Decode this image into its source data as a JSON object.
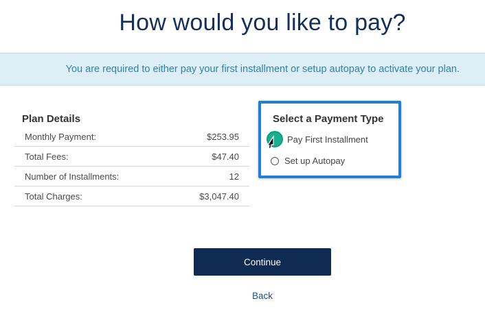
{
  "header": {
    "title": "How would you like to pay?"
  },
  "notice": {
    "text": "You are required to either pay your first installment or setup autopay to activate your plan."
  },
  "plan_details": {
    "title": "Plan Details",
    "rows": [
      {
        "label": "Monthly Payment:",
        "value": "$253.95"
      },
      {
        "label": "Total Fees:",
        "value": "$47.40"
      },
      {
        "label": "Number of Installments:",
        "value": "12"
      },
      {
        "label": "Total Charges:",
        "value": "$3,047.40"
      }
    ]
  },
  "payment_type": {
    "title": "Select a Payment Type",
    "options": [
      {
        "label": "Pay First Installment",
        "selected": true
      },
      {
        "label": "Set up Autopay",
        "selected": false
      }
    ],
    "accent_color": "#1f7fd6",
    "selected_color": "#19b08e"
  },
  "actions": {
    "continue_label": "Continue",
    "back_label": "Back"
  },
  "colors": {
    "primary": "#0f2b52",
    "banner_bg": "#ddeef7",
    "banner_text": "#2f82ab",
    "title": "#14305a"
  }
}
